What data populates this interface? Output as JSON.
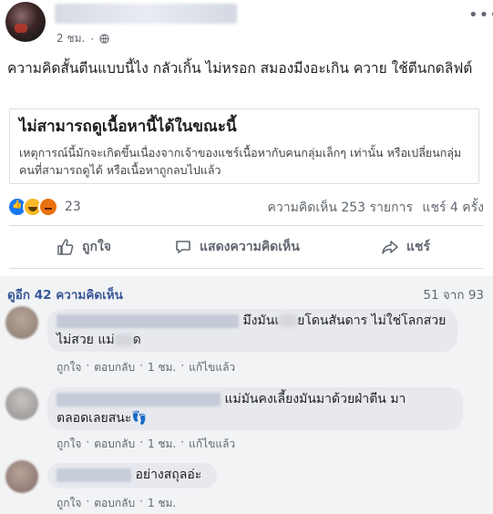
{
  "post": {
    "time": "2 ชม.",
    "dot": "·",
    "more_label": "•••",
    "text": "ความคิดสั้นตีนแบบนี้ไง กลัวเกิ้น ไม่หรอก สมองมีงอะเกิน ควาย ใช้ตีนกดลิฟต์"
  },
  "unavailable": {
    "title": "ไม่สามารถดูเนื้อหานี้ได้ในขณะนี้",
    "message": "เหตุการณ์นี้มักจะเกิดขึ้นเนื่องจากเจ้าของแชร์เนื้อหากับคนกลุ่มเล็กๆ เท่านั้น หรือเปลี่ยนกลุ่มคนที่สามารถดูได้ หรือเนื้อหาถูกลบไปแล้ว"
  },
  "reactions": {
    "count": "23",
    "types": [
      "like-icon",
      "haha-icon",
      "angry-icon"
    ],
    "comments_stat": "ความคิดเห็น 253 รายการ",
    "shares_stat": "แชร์ 4 ครั้ง"
  },
  "actions": {
    "like": "ถูกใจ",
    "comment": "แสดงความคิดเห็น",
    "share": "แชร์"
  },
  "comments_section": {
    "view_more": "ดูอีก 42 ความคิดเห็น",
    "pager": "51 จาก 93",
    "comments": [
      {
        "line1": "มึงมันเ",
        "line1b": "ยโดนสันดาร ไม่ใช่โลกสวย",
        "line2": "ไม่สวย แม่",
        "line2b": "ด",
        "like": "ถูกใจ",
        "reply": "ตอบกลับ",
        "time": "1 ชม.",
        "edited": "แก้ไขแล้ว"
      },
      {
        "line1": "แม่มันคงเลี้ยงมันมาด้วยฝ่าตีน มา",
        "line2": "ตลอดเลยสนะ",
        "emoji": "👣",
        "like": "ถูกใจ",
        "reply": "ตอบกลับ",
        "time": "1 ชม.",
        "edited": "แก้ไขแล้ว"
      },
      {
        "line1": "อย่างสถุลอ่ะ",
        "like": "ถูกใจ",
        "reply": "ตอบกลับ",
        "time": "1 ชม."
      }
    ]
  },
  "colors": {
    "link": "#385898",
    "secondary_text": "#606770",
    "bubble": "#e7e9ee",
    "like_blue": "#1877f2"
  }
}
